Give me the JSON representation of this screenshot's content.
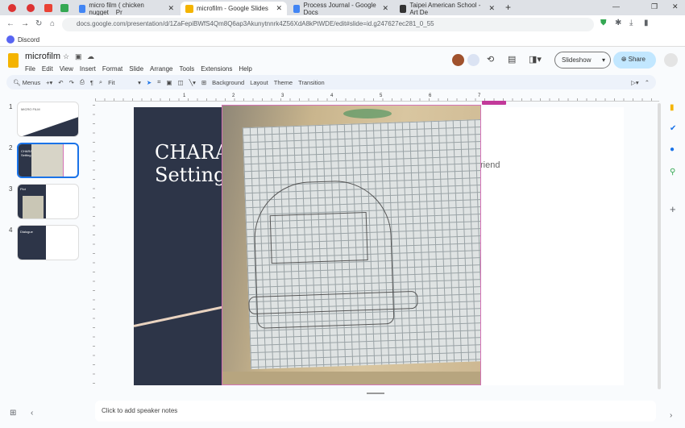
{
  "browser": {
    "tabs": [
      {
        "title": "micro film ( chicken nugget _ Pr"
      },
      {
        "title": "microfilm - Google Slides"
      },
      {
        "title": "Process Journal - Google Docs"
      },
      {
        "title": "Taipei American School - Art De"
      }
    ],
    "url": "docs.google.com/presentation/d/1ZaFepiBWfS4Qm8Q6ap3Akunytnnrk4Z56XdA8kPtWDE/edit#slide=id.g247627ec281_0_55",
    "bookmarks": [
      {
        "label": "Discord"
      }
    ]
  },
  "doc": {
    "title": "microfilm",
    "menu": [
      "File",
      "Edit",
      "View",
      "Insert",
      "Format",
      "Slide",
      "Arrange",
      "Tools",
      "Extensions",
      "Help"
    ],
    "slideshow": "Slideshow",
    "share": "Share"
  },
  "toolbar": {
    "menus": "Menus",
    "zoom": "Fit",
    "background": "Background",
    "layout": "Layout",
    "theme": "Theme",
    "transition": "Transition"
  },
  "ruler": [
    "1",
    "2",
    "3",
    "4",
    "5",
    "6",
    "7"
  ],
  "filmstrip": [
    {
      "num": "1",
      "title": "MICRO FILM"
    },
    {
      "num": "2",
      "title": "CHARA Setting"
    },
    {
      "num": "3",
      "title": "Plot"
    },
    {
      "num": "4",
      "title": "Dialogue"
    }
  ],
  "slide": {
    "title_line1": "CHARA",
    "title_line2": "Setting",
    "body_fragment": "riend"
  },
  "notes": {
    "placeholder": "Click to add speaker notes"
  },
  "colors": {
    "slide_dark": "#2d3548",
    "accent": "#1a73e8",
    "selection": "#d473b6"
  }
}
